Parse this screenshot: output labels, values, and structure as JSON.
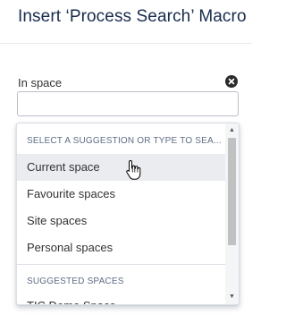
{
  "dialog": {
    "title": "Insert ‘Process Search’ Macro"
  },
  "field": {
    "label": "In space",
    "value": "",
    "placeholder": "",
    "clear_icon": "close-circle-icon"
  },
  "dropdown": {
    "header": "SELECT A SUGGESTION OR TYPE TO SEA...",
    "options": [
      {
        "label": "Current space",
        "highlighted": true
      },
      {
        "label": "Favourite spaces",
        "highlighted": false
      },
      {
        "label": "Site spaces",
        "highlighted": false
      },
      {
        "label": "Personal spaces",
        "highlighted": false
      }
    ],
    "suggested_header": "SUGGESTED SPACES",
    "suggested_partial": "TIC Demo Space"
  },
  "scrollbar": {
    "up_icon": "arrow-up-icon",
    "down_icon": "arrow-down-icon"
  },
  "colors": {
    "highlight": "#ebecf0",
    "header_text": "#5e6c84",
    "title_text": "#172b4d"
  }
}
